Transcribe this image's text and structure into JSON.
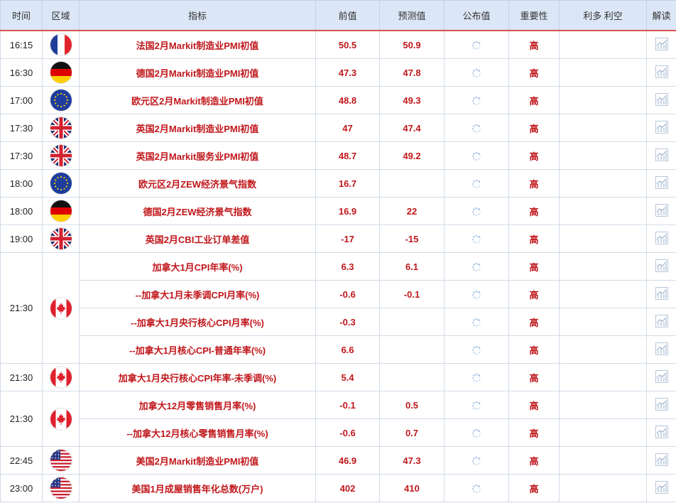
{
  "header": {
    "time": "时间",
    "region": "区域",
    "indicator": "指标",
    "previous": "前值",
    "forecast": "预测值",
    "actual": "公布值",
    "importance": "重要性",
    "impact": "利多 利空",
    "analysis": "解读"
  },
  "groups": [
    {
      "time": "16:15",
      "flag": "france",
      "rows": [
        {
          "name": "法国2月Markit制造业PMI初值",
          "previous": "50.5",
          "forecast": "50.9",
          "importance": "高"
        }
      ]
    },
    {
      "time": "16:30",
      "flag": "germany",
      "rows": [
        {
          "name": "德国2月Markit制造业PMI初值",
          "previous": "47.3",
          "forecast": "47.8",
          "importance": "高"
        }
      ]
    },
    {
      "time": "17:00",
      "flag": "eu",
      "rows": [
        {
          "name": "欧元区2月Markit制造业PMI初值",
          "previous": "48.8",
          "forecast": "49.3",
          "importance": "高"
        }
      ]
    },
    {
      "time": "17:30",
      "flag": "uk",
      "rows": [
        {
          "name": "英国2月Markit制造业PMI初值",
          "previous": "47",
          "forecast": "47.4",
          "importance": "高"
        }
      ]
    },
    {
      "time": "17:30",
      "flag": "uk",
      "rows": [
        {
          "name": "英国2月Markit服务业PMI初值",
          "previous": "48.7",
          "forecast": "49.2",
          "importance": "高"
        }
      ]
    },
    {
      "time": "18:00",
      "flag": "eu",
      "rows": [
        {
          "name": "欧元区2月ZEW经济景气指数",
          "previous": "16.7",
          "forecast": "",
          "importance": "高"
        }
      ]
    },
    {
      "time": "18:00",
      "flag": "germany",
      "rows": [
        {
          "name": "德国2月ZEW经济景气指数",
          "previous": "16.9",
          "forecast": "22",
          "importance": "高"
        }
      ]
    },
    {
      "time": "19:00",
      "flag": "uk",
      "rows": [
        {
          "name": "英国2月CBI工业订单差值",
          "previous": "-17",
          "forecast": "-15",
          "importance": "高"
        }
      ]
    },
    {
      "time": "21:30",
      "flag": "canada",
      "rows": [
        {
          "name": "加拿大1月CPI年率(%)",
          "previous": "6.3",
          "forecast": "6.1",
          "importance": "高"
        },
        {
          "name": "--加拿大1月未季调CPI月率(%)",
          "previous": "-0.6",
          "forecast": "-0.1",
          "importance": "高"
        },
        {
          "name": "--加拿大1月央行核心CPI月率(%)",
          "previous": "-0.3",
          "forecast": "",
          "importance": "高"
        },
        {
          "name": "--加拿大1月核心CPI-普通年率(%)",
          "previous": "6.6",
          "forecast": "",
          "importance": "高"
        }
      ]
    },
    {
      "time": "21:30",
      "flag": "canada",
      "rows": [
        {
          "name": "加拿大1月央行核心CPI年率-未季调(%)",
          "previous": "5.4",
          "forecast": "",
          "importance": "高"
        }
      ]
    },
    {
      "time": "21:30",
      "flag": "canada",
      "rows": [
        {
          "name": "加拿大12月零售销售月率(%)",
          "previous": "-0.1",
          "forecast": "0.5",
          "importance": "高"
        },
        {
          "name": "--加拿大12月核心零售销售月率(%)",
          "previous": "-0.6",
          "forecast": "0.7",
          "importance": "高"
        }
      ]
    },
    {
      "time": "22:45",
      "flag": "usa",
      "rows": [
        {
          "name": "美国2月Markit制造业PMI初值",
          "previous": "46.9",
          "forecast": "47.3",
          "importance": "高"
        }
      ]
    },
    {
      "time": "23:00",
      "flag": "usa",
      "rows": [
        {
          "name": "美国1月成屋销售年化总数(万户)",
          "previous": "402",
          "forecast": "410",
          "importance": "高"
        }
      ]
    }
  ]
}
